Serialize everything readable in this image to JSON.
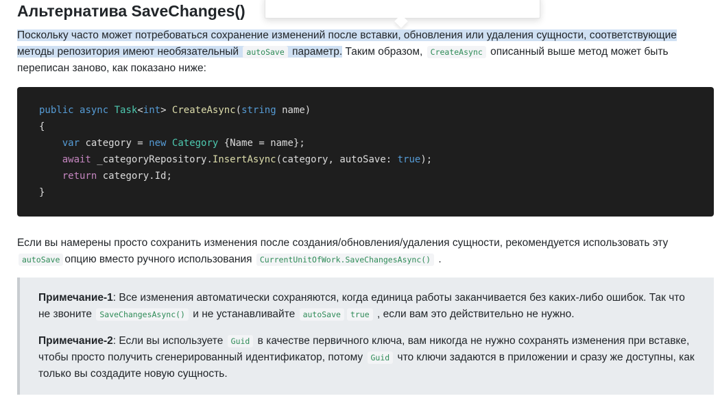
{
  "heading": "Альтернатива SaveChanges()",
  "paragraph1": {
    "highlight_1": "Поскольку часто может потребоваться сохранение изменений после вставки, обновления или удаления сущности, соответствующие методы репозитория имеют необязательный ",
    "code_1": "autoSave",
    "highlight_2": " параметр.",
    "text_1": " Таким образом, ",
    "code_2": "CreateAsync",
    "text_2": " описанный выше метод может быть переписан заново, как показано ниже:"
  },
  "code_block": {
    "language": "csharp",
    "lines": [
      "public async Task<int> CreateAsync(string name)",
      "{",
      "    var category = new Category {Name = name};",
      "    await _categoryRepository.InsertAsync(category, autoSave: true);",
      "    return category.Id;",
      "}"
    ],
    "colors": {
      "background": "#1e1e1e",
      "keyword": "#569cd6",
      "type": "#4ec9b0",
      "method": "#dcdcaa",
      "control": "#c586c0",
      "plain": "#dcdcdc"
    }
  },
  "paragraph2": {
    "text_1": "Если вы намерены просто сохранить изменения после создания/обновления/удаления сущности, рекомендуется использовать эту ",
    "code_1": "autoSave",
    "text_2": "опцию вместо ручного использования ",
    "code_2": "CurrentUnitOfWork.SaveChangesAsync()",
    "text_3": " ."
  },
  "note": {
    "note1": {
      "label": "Примечание-1",
      "text_1": ": Все изменения автоматически сохраняются, когда единица работы заканчивается без каких-либо ошибок. Так что не звоните ",
      "code_1": "SaveChangesAsync()",
      "text_2": " и не устанавливайте ",
      "code_2": "autoSave",
      "code_3": "true",
      "text_3": " , если вам это действительно не нужно."
    },
    "note2": {
      "label": "Примечание-2",
      "text_1": ": Если вы используете ",
      "code_1": "Guid",
      "text_2": " в качестве первичного ключа, вам никогда не нужно сохранять изменения при вставке, чтобы просто получить сгенерированный идентификатор, потому ",
      "code_2": "Guid",
      "text_3": " что ключи задаются в приложении и сразу же доступны, как только вы создадите новую сущность."
    }
  },
  "colors": {
    "selection_highlight": "#cfe0f3",
    "inline_code": "#2e8b57",
    "note_background": "#e9ecef"
  }
}
